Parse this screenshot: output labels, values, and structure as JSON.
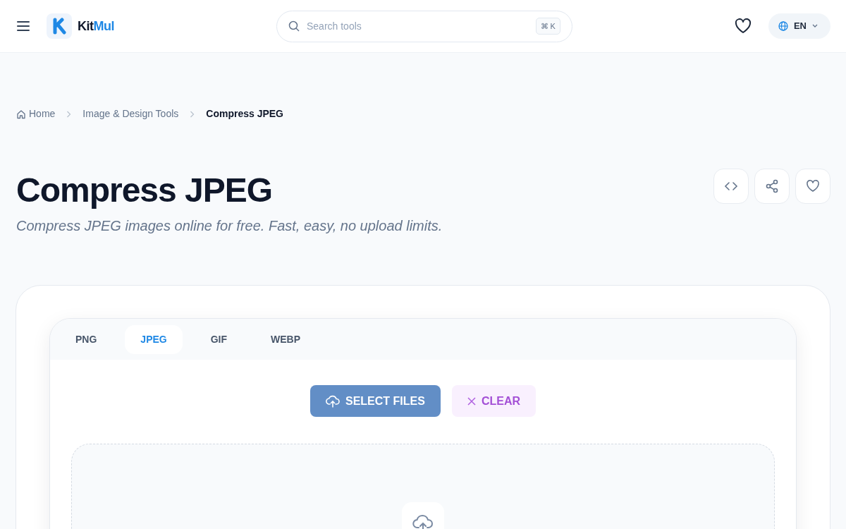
{
  "header": {
    "brand": {
      "dark": "Kit",
      "accent": "Mul"
    },
    "search": {
      "placeholder": "Search tools",
      "shortcut": "⌘ K"
    },
    "language": "EN"
  },
  "breadcrumb": [
    {
      "label": "Home",
      "kind": "home"
    },
    {
      "label": "Image & Design Tools",
      "kind": "link"
    },
    {
      "label": "Compress JPEG",
      "kind": "current"
    }
  ],
  "title": "Compress JPEG",
  "subtitle": "Compress JPEG images online for free. Fast, easy, no upload limits.",
  "actions": [
    {
      "kind": "embed"
    },
    {
      "kind": "share"
    },
    {
      "kind": "favorite"
    }
  ],
  "tabs": [
    {
      "label": "PNG",
      "selected": false
    },
    {
      "label": "JPEG",
      "selected": true
    },
    {
      "label": "GIF",
      "selected": false
    },
    {
      "label": "WEBP",
      "selected": false
    }
  ],
  "buttons": [
    {
      "label": "SELECT FILES",
      "kind": "upload",
      "disabled": false
    },
    {
      "label": "CLEAR",
      "kind": "clear",
      "disabled": true
    }
  ]
}
